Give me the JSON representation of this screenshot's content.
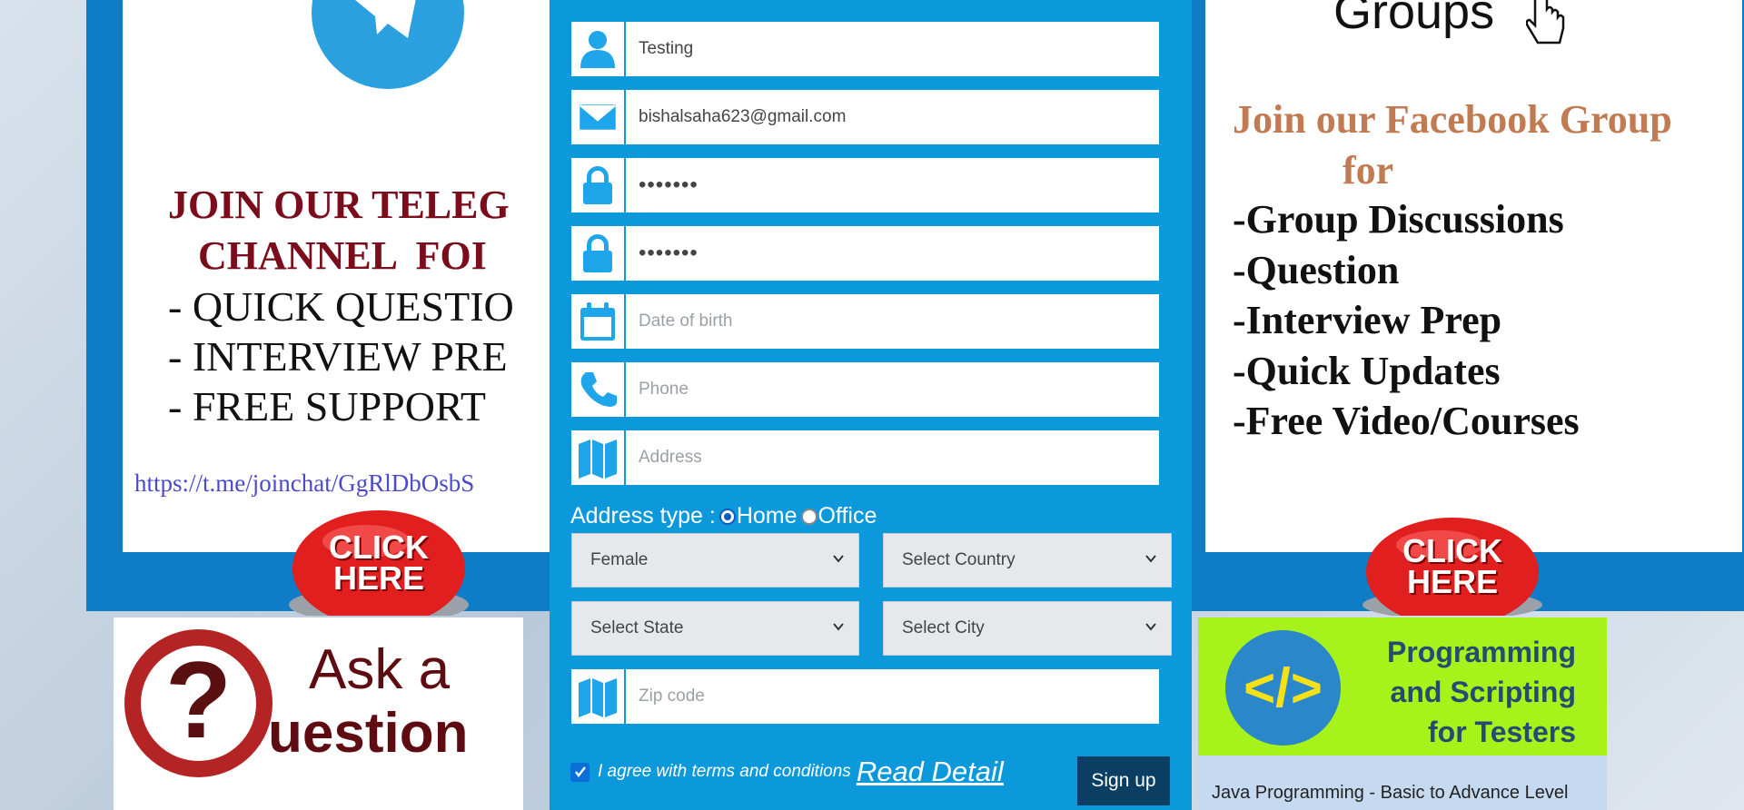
{
  "telegram_banner": {
    "heading": "JOIN OUR TELEG\n   CHANNEL  FOI",
    "points": "- QUICK QUESTIO\n- INTERVIEW PRE\n- FREE SUPPORT",
    "link": "https://t.me/joinchat/GgRlDbOsbS",
    "click_label": "CLICK\nHERE"
  },
  "facebook_banner": {
    "groups_text": "Groups",
    "heading": "Join our Facebook Group\n           for",
    "points": "-Group Discussions\n-Question\n-Interview Prep\n-Quick Updates\n-Free Video/Courses",
    "click_label": "CLICK\nHERE"
  },
  "ask_banner": {
    "q_glyph": "?",
    "line1": "Ask a",
    "line2": "uestion"
  },
  "programming_banner": {
    "glyph": "</>",
    "title": "Programming\nand Scripting\nfor Testers",
    "subtitle": "Java Programming - Basic to Advance Level"
  },
  "form": {
    "name_value": "Testing",
    "email_value": "bishalsaha623@gmail.com",
    "password_value": "•••••••",
    "confirm_value": "•••••••",
    "dob_placeholder": "Date of birth",
    "phone_placeholder": "Phone",
    "address_placeholder": "Address",
    "address_type_label": "Address type : ",
    "home_label": "Home",
    "office_label": "Office",
    "gender_value": "Female",
    "country_value": "Select Country",
    "state_value": "Select State",
    "city_value": "Select City",
    "zip_placeholder": "Zip code",
    "agree_text": "I agree with terms and conditions",
    "read_detail": "Read Detail",
    "signup_label": "Sign up"
  },
  "colors": {
    "form_bg": "#0b99dc",
    "icon": "#1fa5e9",
    "signup_bg": "#0a3f63"
  }
}
